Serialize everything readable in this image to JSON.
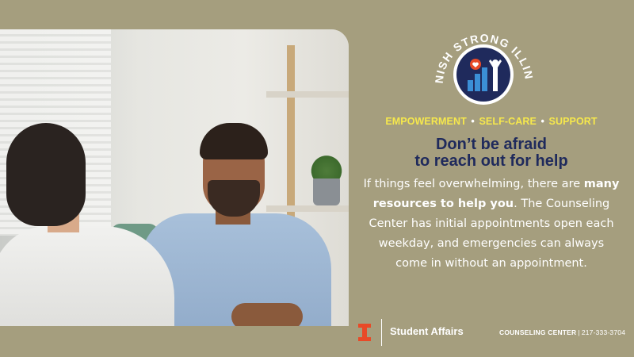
{
  "brand": {
    "campaign_text": "#FINISH STRONG ILLINOIS",
    "colors": {
      "background": "#a59e7e",
      "navy": "#1f2a5c",
      "accent_yellow": "#f6e84c",
      "illinois_orange": "#e84a27",
      "white": "#ffffff"
    }
  },
  "tagline": {
    "item1": "EMPOWERMENT",
    "item2": "SELF-CARE",
    "item3": "SUPPORT",
    "separator": "•"
  },
  "headline": {
    "line1": "Don’t be afraid",
    "line2": "to reach out for help"
  },
  "body": {
    "part1": "If things feel overwhelming, there are ",
    "bold": "many resources to help you",
    "part2": ". The Counseling Center has initial appointments open each weekday, and emergencies can always come in without an appointment."
  },
  "footer": {
    "org": "Student Affairs",
    "dept": "COUNSELING CENTER",
    "separator": "|",
    "phone": "217-333-3704"
  },
  "icons": [
    "campaign-logo-icon",
    "heart-icon",
    "bar-chart-icon",
    "person-cheering-icon",
    "illinois-i-icon"
  ]
}
